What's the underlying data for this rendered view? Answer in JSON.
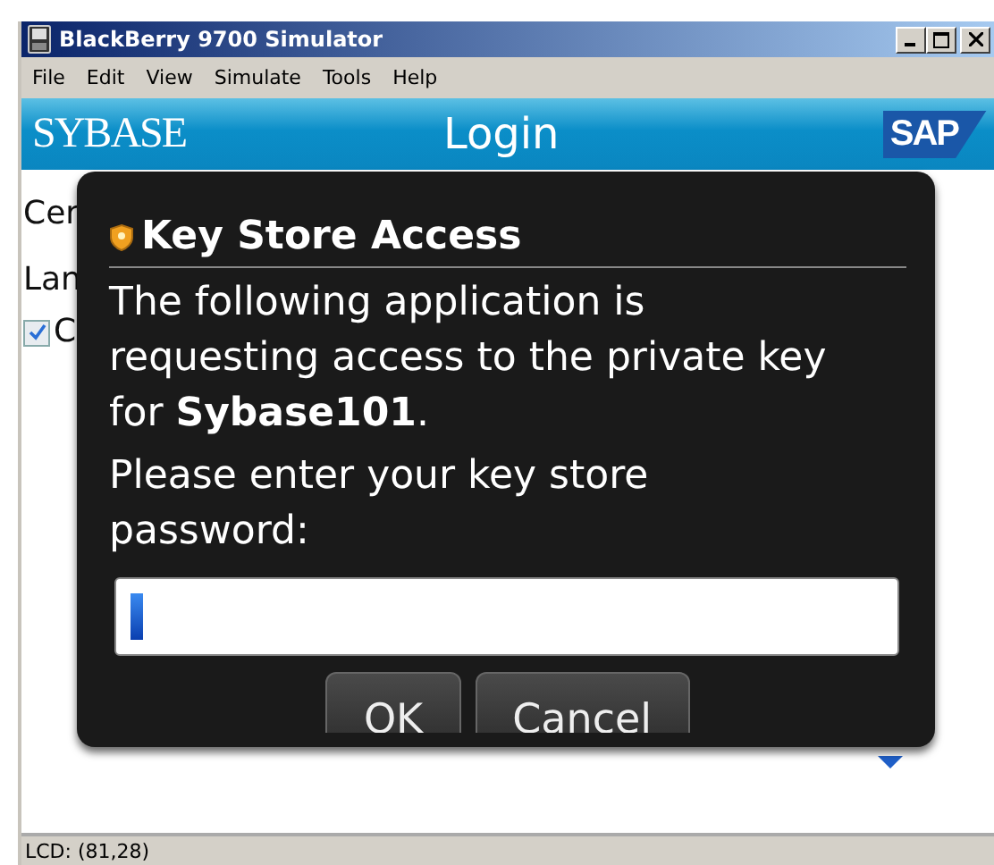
{
  "window": {
    "title": "BlackBerry 9700 Simulator"
  },
  "menu": [
    "File",
    "Edit",
    "View",
    "Simulate",
    "Tools",
    "Help"
  ],
  "header": {
    "brand": "SYBASE",
    "title": "Login",
    "logo": "SAP"
  },
  "background_fields": [
    {
      "kind": "label",
      "text": "Cer"
    },
    {
      "kind": "label",
      "text": "Lan"
    },
    {
      "kind": "checkbox",
      "text": "C",
      "checked": true
    }
  ],
  "dialog": {
    "title": "Key Store Access",
    "message": "The following application is requesting access to the private key for **Sybase101**.",
    "prompt": "Please enter your key store password:",
    "buttons": [
      "OK",
      "Cancel"
    ]
  },
  "status_bar": "LCD: (81,28)"
}
